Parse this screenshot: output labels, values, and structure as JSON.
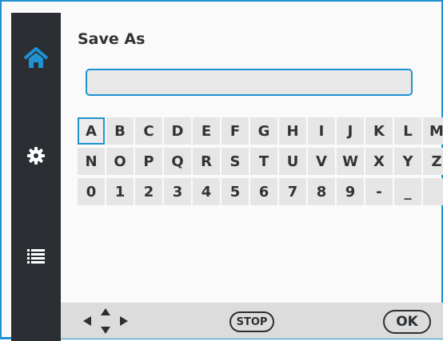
{
  "dialog": {
    "title": "Save As",
    "filename_value": ""
  },
  "sidebar": {
    "items": [
      {
        "icon": "home-icon",
        "active": true
      },
      {
        "icon": "gear-icon",
        "active": false
      },
      {
        "icon": "list-icon",
        "active": false
      }
    ]
  },
  "keyboard": {
    "rows": [
      [
        "A",
        "B",
        "C",
        "D",
        "E",
        "F",
        "G",
        "H",
        "I",
        "J",
        "K",
        "L",
        "M"
      ],
      [
        "N",
        "O",
        "P",
        "Q",
        "R",
        "S",
        "T",
        "U",
        "V",
        "W",
        "X",
        "Y",
        "Z"
      ],
      [
        "0",
        "1",
        "2",
        "3",
        "4",
        "5",
        "6",
        "7",
        "8",
        "9",
        "-",
        "_",
        ""
      ]
    ],
    "selected_key": "A"
  },
  "bottombar": {
    "nav_icon": "direction-arrows-icon",
    "stop_label": "STOP",
    "ok_label": "OK"
  },
  "colors": {
    "accent": "#1f93d2",
    "sidebar": "#2b2f33",
    "key_background": "#e6e6e6",
    "bottombar": "#dcdcdc"
  }
}
